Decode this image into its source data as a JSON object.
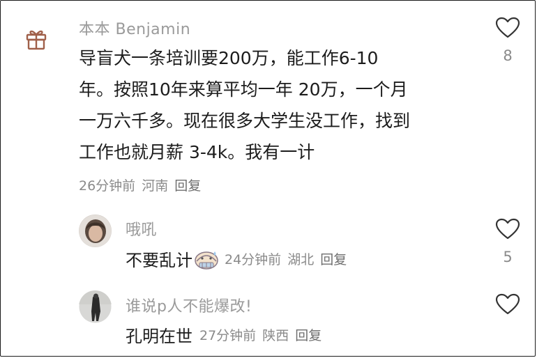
{
  "comment": {
    "username": "本本 Benjamin",
    "lines": [
      "导盲犬一条培训要200万，能工作6-10",
      "年。按照10年来算平均一年 20万，一个月",
      "一万六千多。现在很多大学生没工作，找到",
      "工作也就月薪 3-4k。我有一计"
    ],
    "time": "26分钟前",
    "location": "河南",
    "reply_label": "回复",
    "likes": "8"
  },
  "replies": [
    {
      "username": "哦吼",
      "text": "不要乱计",
      "time": "24分钟前",
      "location": "湖北",
      "reply_label": "回复",
      "likes": "5"
    },
    {
      "username": "谁说p人不能爆改!",
      "text": "孔明在世",
      "time": "27分钟前",
      "location": "陕西",
      "reply_label": "回复",
      "likes": ""
    }
  ],
  "colors": {
    "text": "#1c1c1c",
    "muted": "#8a8a8a",
    "heart_stroke": "#333333",
    "gift_icon": "#a0604a"
  },
  "icons": [
    "gift-icon",
    "heart-icon",
    "sweat-emoji-icon"
  ]
}
